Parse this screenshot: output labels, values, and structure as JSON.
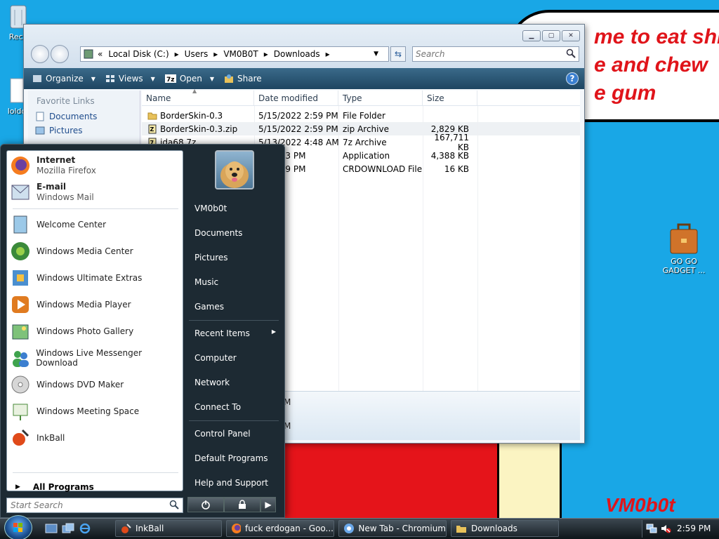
{
  "wallpaper": {
    "bubble_lines": [
      "me to eat shit",
      "e and chew",
      "e gum"
    ],
    "signature": "VM0b0t"
  },
  "desktop_icons": [
    {
      "label": "Recy",
      "icon": "recycle-bin-icon"
    },
    {
      "label": "loldo",
      "icon": "document-icon"
    },
    {
      "label": "GO GO GADGET ...",
      "icon": "briefcase-icon"
    }
  ],
  "explorer": {
    "breadcrumb": [
      "Local Disk (C:)",
      "Users",
      "VM0B0T",
      "Downloads"
    ],
    "search_placeholder": "Search",
    "toolbar": [
      {
        "label": "Organize",
        "icon": "organize-icon"
      },
      {
        "label": "Views",
        "icon": "views-icon"
      },
      {
        "label": "Open",
        "icon": "7zip-icon"
      },
      {
        "label": "Share",
        "icon": "share-icon"
      }
    ],
    "help": "?",
    "favorite_links_header": "Favorite Links",
    "favorite_links": [
      "Documents",
      "Pictures"
    ],
    "columns": [
      "Name",
      "Date modified",
      "Type",
      "Size"
    ],
    "files": [
      {
        "name": "BorderSkin-0.3",
        "date": "5/15/2022 2:59 PM",
        "type": "File Folder",
        "size": "",
        "icon": "folder-icon"
      },
      {
        "name": "BorderSkin-0.3.zip",
        "date": "5/15/2022 2:59 PM",
        "type": "zip Archive",
        "size": "2,829 KB",
        "icon": "zip-file-icon"
      },
      {
        "name": "ida68.7z",
        "date": "5/13/2022 4:48 AM",
        "type": "7z Archive",
        "size": "167,711 KB",
        "icon": "7z-file-icon"
      },
      {
        "name": "",
        "date": "22 7:23 PM",
        "type": "Application",
        "size": "4,388 KB",
        "icon": "application-icon"
      },
      {
        "name": "",
        "date": "22 2:59 PM",
        "type": "CRDOWNLOAD File",
        "size": "16 KB",
        "icon": "file-icon"
      }
    ],
    "details_fragments": [
      "M",
      "M"
    ]
  },
  "start_menu": {
    "pinned": [
      {
        "title": "Internet",
        "subtitle": "Mozilla Firefox",
        "icon": "firefox-icon"
      },
      {
        "title": "E-mail",
        "subtitle": "Windows Mail",
        "icon": "mail-icon"
      }
    ],
    "programs": [
      {
        "label": "Welcome Center",
        "icon": "welcome-center-icon"
      },
      {
        "label": "Windows Media Center",
        "icon": "media-center-icon"
      },
      {
        "label": "Windows Ultimate Extras",
        "icon": "ultimate-extras-icon"
      },
      {
        "label": "Windows Media Player",
        "icon": "media-player-icon"
      },
      {
        "label": "Windows Photo Gallery",
        "icon": "photo-gallery-icon"
      },
      {
        "label": "Windows Live Messenger Download",
        "icon": "messenger-icon"
      },
      {
        "label": "Windows DVD Maker",
        "icon": "dvd-maker-icon"
      },
      {
        "label": "Windows Meeting Space",
        "icon": "meeting-space-icon"
      },
      {
        "label": "InkBall",
        "icon": "inkball-icon"
      }
    ],
    "all_programs": "All Programs",
    "search_placeholder": "Start Search",
    "user_name": "VM0b0t",
    "right_items": [
      "Documents",
      "Pictures",
      "Music",
      "Games",
      "Recent Items",
      "Computer",
      "Network",
      "Connect To",
      "Control Panel",
      "Default Programs",
      "Help and Support"
    ],
    "power": {
      "power_icon": "power-icon",
      "lock_icon": "lock-icon",
      "arrow": "▶"
    }
  },
  "taskbar": {
    "buttons": [
      {
        "label": "InkBall",
        "icon": "inkball-icon"
      },
      {
        "label": "fuck erdogan - Goo...",
        "icon": "firefox-icon"
      },
      {
        "label": "New Tab - Chromium",
        "icon": "chromium-icon"
      },
      {
        "label": "Downloads",
        "icon": "folder-icon"
      }
    ],
    "clock": "2:59 PM"
  }
}
